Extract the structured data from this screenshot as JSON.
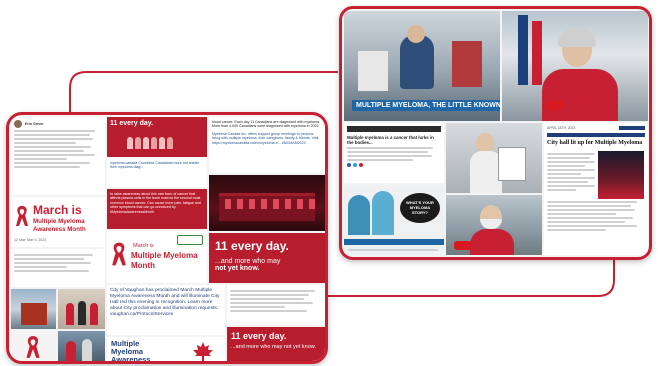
{
  "colors": {
    "accent": "#c62032",
    "dark_red": "#8e1424",
    "brand_blue": "#1f66a7"
  },
  "left": {
    "tweet1": {
      "author": "Erin Green"
    },
    "tweet2": {
      "date": "12 Mar: Mar 9, 2023"
    },
    "eleven_small": "11 every day.",
    "eleven_caption": "myeloma.canada Countless Canadians more not realize their myeloma diag...",
    "blood_text": "blood cancer. Each day 11 Canadians are diagnosed with myeloma. More than 4,000 Canadians were diagnosed with myeloma in 2022.",
    "support_text": "Myeloma Canada Inc. offers support group meetings to persons living with multiple myeloma, their caregivers, family & friends. Visit: https://myelomacanada.ca/en/myeloma-n... #MCMAM2023",
    "march_title": "March is",
    "march_sub1": "Multiple Myeloma",
    "march_sub2": "Awareness Month",
    "awareness_text": "to raise awareness about this rare form of cancer that affects plasma cells in the bone marrow the second most common blood cancer. Can cause bone pain, fatigue and other symptoms that can go unnoticed by #MyelomaAwarenessMonth",
    "march_card_line1": "March is",
    "march_card_line2": "Multiple Myeloma",
    "march_card_line3": "Month",
    "eleven_big": "11 every day.",
    "eleven_big_sub1": "...and more who may",
    "eleven_big_sub2": "not yet know.",
    "vaughan_text": "City of Vaughan has proclaimed March Multiple Myeloma Awareness Month and will illuminate City Hall red this evening in recognition. Learn more about City proclamation and illumination requests: vaughan.ca/ProtocolServices",
    "mm_awareness1": "Multiple",
    "mm_awareness2": "Myeloma",
    "mm_awareness3": "Awareness",
    "eleven_small2": "11 every day.",
    "eleven_small2_sub": "...and more who may not yet know."
  },
  "right": {
    "news_caption": "MULTIPLE MYELOMA, THE LITTLE KNOWN CANCER",
    "article_title": "Multiple myeloma is a cancer that lurks in the bodies...",
    "story_badge": "WHAT'S YOUR MYELOMA STORY?",
    "cityhall_date": "APRIL 18TH, 2023",
    "cityhall_title": "City hall lit up for Multiple Myeloma"
  },
  "icons": [
    "ribbon-icon",
    "maple-leaf-icon",
    "play-icon",
    "news-logo-icon"
  ]
}
